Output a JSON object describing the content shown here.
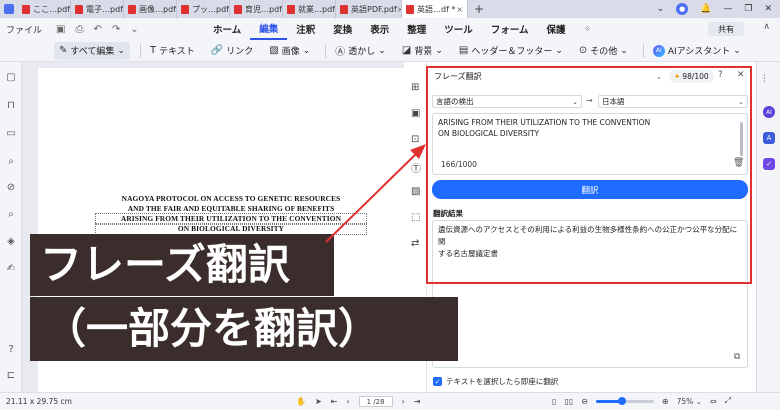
{
  "tabs": [
    {
      "label": "ここ…pdf"
    },
    {
      "label": "電子…pdf"
    },
    {
      "label": "画像…pdf"
    },
    {
      "label": "プッ…pdf"
    },
    {
      "label": "育児…pdf"
    },
    {
      "label": "就業…pdf"
    },
    {
      "label": "英語PDF.pdf"
    },
    {
      "label": "英語…df *",
      "active": true
    }
  ],
  "menubar": {
    "file": "ファイル",
    "menus": [
      "ホーム",
      "編集",
      "注釈",
      "変換",
      "表示",
      "整理",
      "ツール",
      "フォーム",
      "保護"
    ],
    "active_menu": "編集",
    "share": "共有"
  },
  "toolbar": {
    "edit_all": "すべて編集",
    "text": "テキスト",
    "link": "リンク",
    "image": "画像",
    "watermark": "透かし",
    "background": "背景",
    "header_footer": "ヘッダー＆フッター",
    "other": "その他",
    "ai_assistant": "AIアシスタント"
  },
  "document": {
    "title_lines": [
      "NAGOYA PROTOCOL ON ACCESS TO GENETIC RESOURCES",
      "AND THE FAIR AND EQUITABLE SHARING OF BENEFITS",
      "ARISING FROM THEIR UTILIZATION TO THE CONVENTION",
      "ON BIOLOGICAL DIVERSITY"
    ]
  },
  "panel": {
    "mode": "フレーズ翻訳",
    "credits": "98/100",
    "source_lang": "言語の検出",
    "target_lang": "日本語",
    "source_text_lines": [
      "ARISING FROM THEIR UTILIZATION TO THE CONVENTION",
      "ON BIOLOGICAL DIVERSITY"
    ],
    "char_count": "166/1000",
    "translate_button": "翻訳",
    "result_label": "翻訳結果",
    "result_text_lines": [
      "遺伝資源へのアクセスとその利用による利益の生物多様性条約への公正かつ公平な分配に関",
      "する名古屋議定書"
    ],
    "auto_translate_label": "テキストを選択したら即座に翻訳",
    "auto_translate_checked": true
  },
  "status": {
    "dimensions": "21.11 x 29.75 cm",
    "page_indicator": "1 /28",
    "zoom": "75%",
    "zoom_fraction": 0.45
  },
  "overlay": {
    "line1": "フレーズ翻訳",
    "line2": "（一部分を翻訳）"
  },
  "colors": {
    "accent": "#1f6bff",
    "highlight_box": "#e03131",
    "overlay_bg": "#3a2d2b"
  }
}
